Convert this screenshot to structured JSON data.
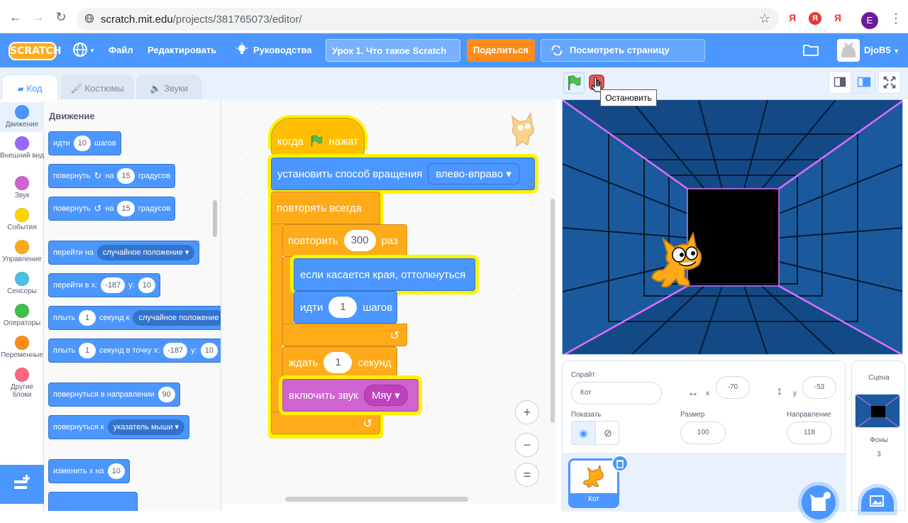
{
  "browser": {
    "url_host": "scratch.mit.edu",
    "url_path": "/projects/381765073/editor/",
    "profile_initial": "E",
    "ext1": "Я",
    "ext2": "Я",
    "ext3": "Я"
  },
  "menubar": {
    "logo": "SCRATCH",
    "file": "Файл",
    "edit": "Редактировать",
    "tutorials": "Руководства",
    "project_title": "Урок 1. Что такое Scratch",
    "share": "Поделиться",
    "see_project_page": "Посмотреть страницу проекта",
    "username": "DjoB5"
  },
  "tabs": {
    "code": "Код",
    "costumes": "Костюмы",
    "sounds": "Звуки"
  },
  "categories": [
    {
      "label": "Движение",
      "color": "#4c97ff"
    },
    {
      "label": "Внешний вид",
      "color": "#9966ff"
    },
    {
      "label": "Звук",
      "color": "#cf63cf"
    },
    {
      "label": "События",
      "color": "#ffd500"
    },
    {
      "label": "Управление",
      "color": "#ffab19"
    },
    {
      "label": "Сенсоры",
      "color": "#4cbfe6"
    },
    {
      "label": "Операторы",
      "color": "#40bf4a"
    },
    {
      "label": "Переменные",
      "color": "#ff8c1a"
    },
    {
      "label": "Другие блоки",
      "color": "#ff6680"
    }
  ],
  "palette": {
    "title": "Движение",
    "move": {
      "a": "идти",
      "steps": "10",
      "b": "шагов"
    },
    "turn_right": {
      "a": "повернуть",
      "b": "на",
      "deg": "15",
      "c": "градусов"
    },
    "turn_left": {
      "a": "повернуть",
      "b": "на",
      "deg": "15",
      "c": "градусов"
    },
    "goto": {
      "a": "перейти на",
      "target": "случайное положение"
    },
    "goto_xy": {
      "a": "перейти в x:",
      "x": "-187",
      "b": "y:",
      "y": "10"
    },
    "glide": {
      "a": "плыть",
      "secs": "1",
      "b": "секунд к",
      "target": "случайное положение"
    },
    "glide_xy": {
      "a": "плыть",
      "secs": "1",
      "b": "секунд в точку x:",
      "x": "-187",
      "c": "y:",
      "y": "10"
    },
    "point_dir": {
      "a": "повернуться в направлении",
      "dir": "90"
    },
    "point_towards": {
      "a": "повернуться к",
      "target": "указатель мыши"
    },
    "change_x": {
      "a": "изменить х на",
      "val": "10"
    }
  },
  "script": {
    "hat_a": "когда",
    "hat_b": "нажат",
    "rotation": "установить способ вращения",
    "rotation_value": "влево-вправо",
    "forever": "повторять всегда",
    "repeat": "повторить",
    "repeat_count": "300",
    "repeat_b": "раз",
    "bounce": "если касается края, оттолкнуться",
    "move_a": "идти",
    "move_steps": "1",
    "move_b": "шагов",
    "wait_a": "ждать",
    "wait_secs": "1",
    "wait_b": "секунд",
    "sound_a": "включить звук",
    "sound_value": "Мяу"
  },
  "zoom": {
    "in": "+",
    "out": "−",
    "reset": "="
  },
  "stage": {
    "tooltip": "Остановить"
  },
  "sprite_info": {
    "sprite_label": "Спрайт",
    "sprite_name": "Кот",
    "x_label": "x",
    "x": "-70",
    "y_label": "y",
    "y": "-53",
    "show_label": "Показать",
    "size_label": "Размер",
    "size": "100",
    "direction_label": "Направление",
    "direction": "118",
    "thumb_name": "Кот"
  },
  "stage_pane": {
    "title": "Сцена",
    "backdrops_label": "Фоны",
    "backdrops_count": "3"
  },
  "colors": {
    "motion": "#4c97ff",
    "control": "#ffab19",
    "events": "#ffbf00",
    "sound": "#cf63cf",
    "glow": "#fff200"
  }
}
